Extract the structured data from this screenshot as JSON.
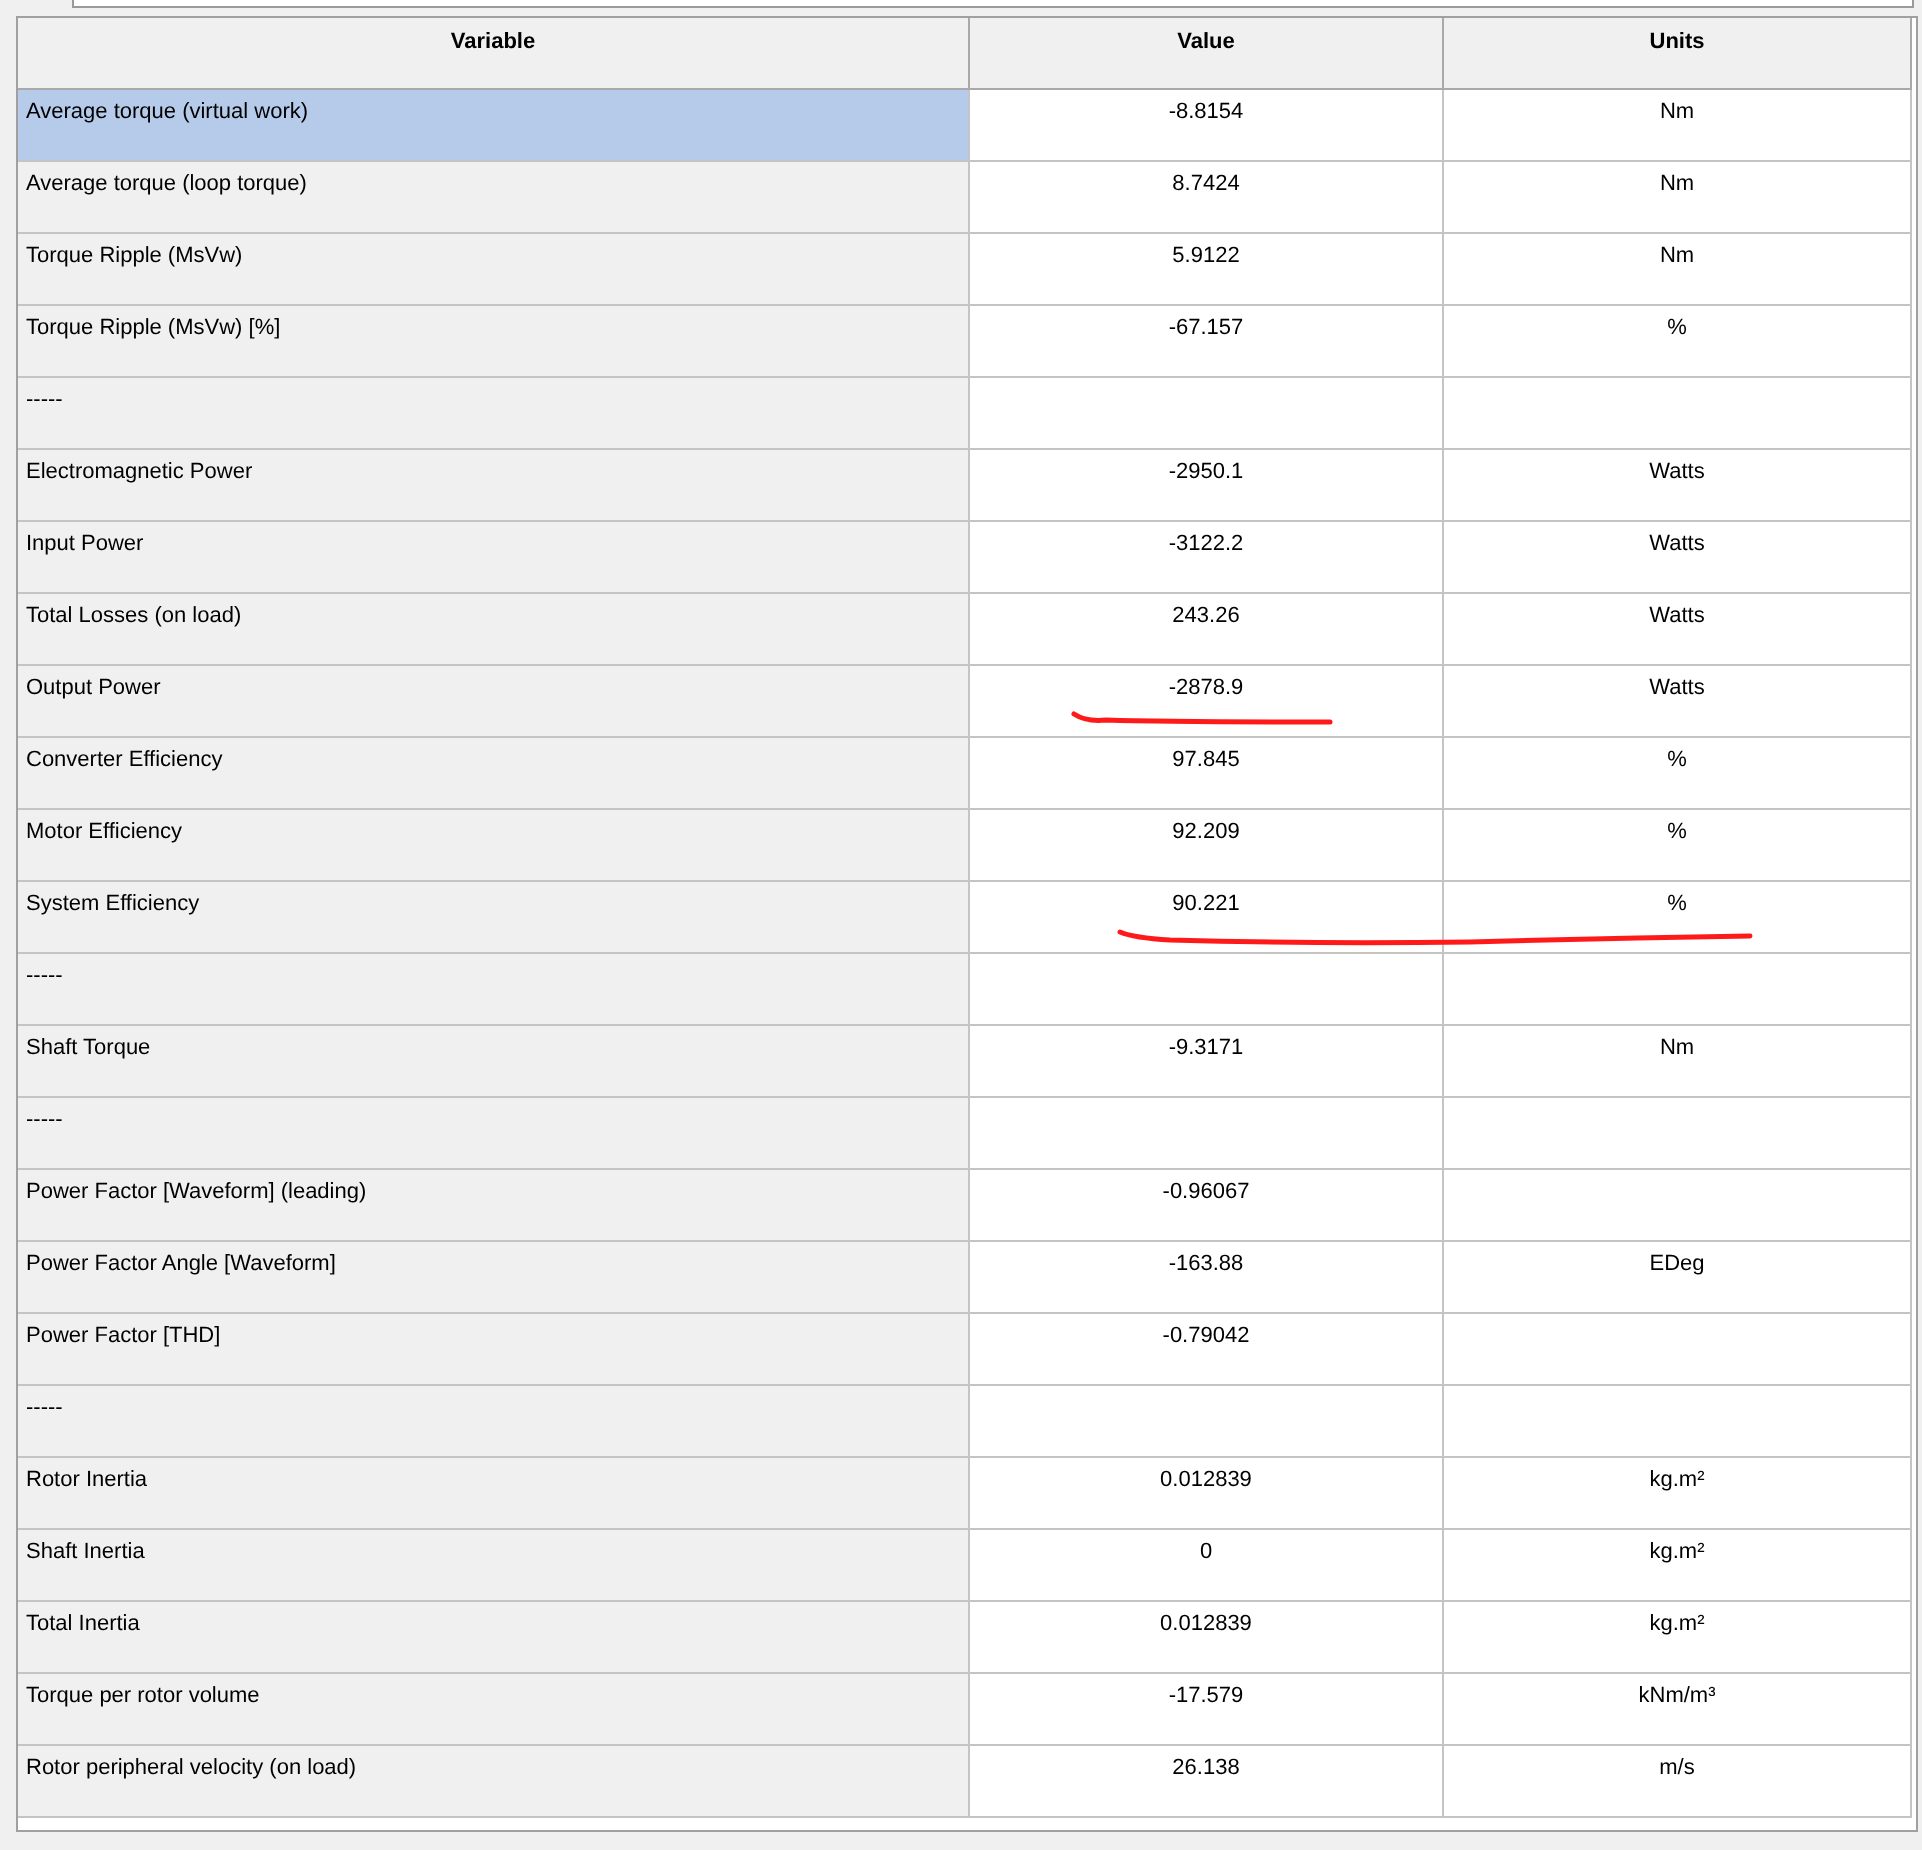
{
  "table": {
    "columns": [
      "Variable",
      "Value",
      "Units"
    ],
    "rows": [
      {
        "variable": "Average torque (virtual work)",
        "value": "-8.8154",
        "units": "Nm",
        "selected": true
      },
      {
        "variable": "Average torque (loop torque)",
        "value": "8.7424",
        "units": "Nm",
        "selected": false
      },
      {
        "variable": "Torque Ripple (MsVw)",
        "value": "5.9122",
        "units": "Nm",
        "selected": false
      },
      {
        "variable": "Torque Ripple (MsVw) [%]",
        "value": "-67.157",
        "units": "%",
        "selected": false
      },
      {
        "variable": "-----",
        "selected": false
      },
      {
        "variable": "Electromagnetic Power",
        "value": "-2950.1",
        "units": "Watts",
        "selected": false
      },
      {
        "variable": "Input Power",
        "value": "-3122.2",
        "units": "Watts",
        "selected": false
      },
      {
        "variable": "Total Losses (on load)",
        "value": "243.26",
        "units": "Watts",
        "selected": false
      },
      {
        "variable": "Output Power",
        "value": "-2878.9",
        "units": "Watts",
        "selected": false,
        "value_underlined": true
      },
      {
        "variable": "Converter Efficiency",
        "value": "97.845",
        "units": "%",
        "selected": false
      },
      {
        "variable": "Motor Efficiency",
        "value": "92.209",
        "units": "%",
        "selected": false
      },
      {
        "variable": "System Efficiency",
        "value": "90.221",
        "units": "%",
        "selected": false,
        "value_underlined": true,
        "units_underlined": true
      },
      {
        "variable": "-----",
        "selected": false
      },
      {
        "variable": "Shaft Torque",
        "value": "-9.3171",
        "units": "Nm",
        "selected": false
      },
      {
        "variable": "-----",
        "selected": false
      },
      {
        "variable": "Power Factor [Waveform] (leading)",
        "value": "-0.96067",
        "selected": false
      },
      {
        "variable": "Power Factor Angle [Waveform]",
        "value": "-163.88",
        "units": "EDeg",
        "selected": false
      },
      {
        "variable": "Power Factor [THD]",
        "value": "-0.79042",
        "selected": false
      },
      {
        "variable": "-----",
        "selected": false
      },
      {
        "variable": "Rotor Inertia",
        "value": "0.012839",
        "units": "kg.m²",
        "selected": false
      },
      {
        "variable": "Shaft Inertia",
        "value": "0",
        "units": "kg.m²",
        "selected": false
      },
      {
        "variable": "Total Inertia",
        "value": "0.012839",
        "units": "kg.m²",
        "selected": false
      },
      {
        "variable": "Torque per rotor volume",
        "value": "-17.579",
        "units": "kNm/m³",
        "selected": false
      },
      {
        "variable": "Rotor peripheral velocity (on load)",
        "value": "26.138",
        "units": "m/s",
        "selected": false
      }
    ]
  }
}
